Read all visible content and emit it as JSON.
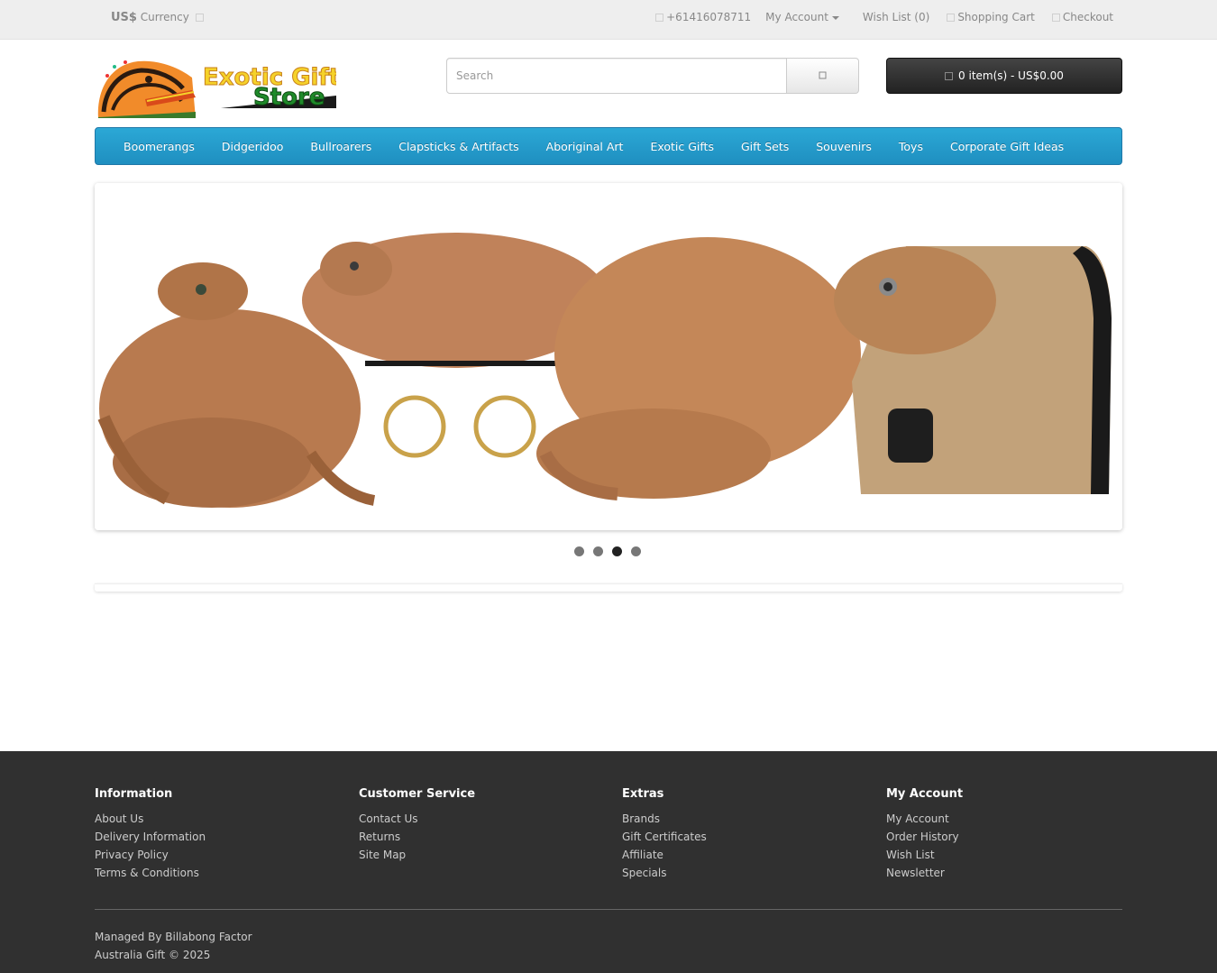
{
  "topbar": {
    "currency_symbol": "US$",
    "currency_label": "Currency",
    "phone": "+61416078711",
    "my_account": "My Account",
    "wishlist": "Wish List (0)",
    "shopping_cart": "Shopping Cart",
    "checkout": "Checkout"
  },
  "header": {
    "logo_text_1": "Exotic Gifts",
    "logo_text_2": "Store",
    "search_placeholder": "Search",
    "cart_label": "0 item(s) - US$0.00"
  },
  "menu": [
    "Boomerangs",
    "Didgeridoo",
    "Bullroarers",
    "Clapsticks & Artifacts",
    "Aboriginal Art",
    "Exotic Gifts",
    "Gift Sets",
    "Souvenirs",
    "Toys",
    "Corporate Gift Ideas"
  ],
  "slideshow": {
    "slide_count": 4,
    "active_index": 2
  },
  "footer": {
    "columns": [
      {
        "title": "Information",
        "links": [
          "About Us",
          "Delivery Information",
          "Privacy Policy",
          "Terms & Conditions"
        ]
      },
      {
        "title": "Customer Service",
        "links": [
          "Contact Us",
          "Returns",
          "Site Map"
        ]
      },
      {
        "title": "Extras",
        "links": [
          "Brands",
          "Gift Certificates",
          "Affiliate",
          "Specials"
        ]
      },
      {
        "title": "My Account",
        "links": [
          "My Account",
          "Order History",
          "Wish List",
          "Newsletter"
        ]
      }
    ],
    "powered_line_1": "Managed By Billabong Factor",
    "powered_line_2": "Australia Gift © 2025"
  },
  "colors": {
    "menu_blue": "#1f8fc0",
    "footer_bg": "#303030",
    "topbar_bg": "#eeeeee"
  }
}
